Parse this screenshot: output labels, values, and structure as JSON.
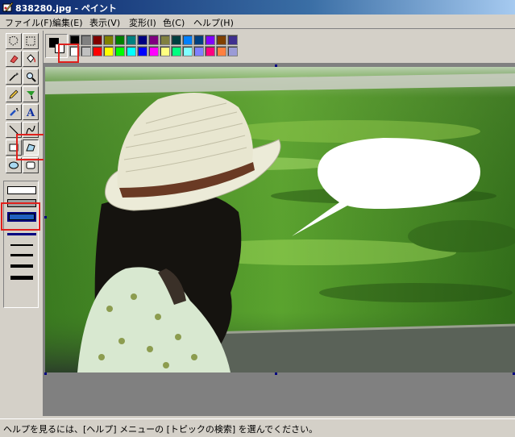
{
  "window": {
    "title": "838280.jpg - ペイント"
  },
  "menu": [
    "ファイル(F)",
    "編集(E)",
    "表示(V)",
    "変形(I)",
    "色(C)",
    "ヘルプ(H)"
  ],
  "status": {
    "text": "ヘルプを見るには、[ヘルプ] メニューの [トピックの検索] を選んでください。"
  },
  "palette": {
    "row1": [
      "#000000",
      "#808080",
      "#800000",
      "#808000",
      "#008000",
      "#008080",
      "#000080",
      "#800080",
      "#808040",
      "#004040",
      "#0080ff",
      "#004080",
      "#8000ff",
      "#804000",
      "#3f2f8f"
    ],
    "row2": [
      "#ffffff",
      "#c0c0c0",
      "#ff0000",
      "#ffff00",
      "#00ff00",
      "#00ffff",
      "#0000ff",
      "#ff00ff",
      "#ffff80",
      "#00ff80",
      "#80ffff",
      "#8080ff",
      "#ff0080",
      "#ff8040",
      "#9b9bd6"
    ],
    "foreground": "#000000",
    "background": "#ffffff"
  },
  "tools": [
    "free-form-select",
    "select",
    "eraser",
    "fill",
    "pick-color",
    "magnifier",
    "pencil",
    "brush",
    "airbrush",
    "text",
    "line",
    "curve",
    "rectangle",
    "polygon",
    "ellipse",
    "rounded-rectangle"
  ],
  "selected_tool": "polygon",
  "selected_option": "filled-outline"
}
